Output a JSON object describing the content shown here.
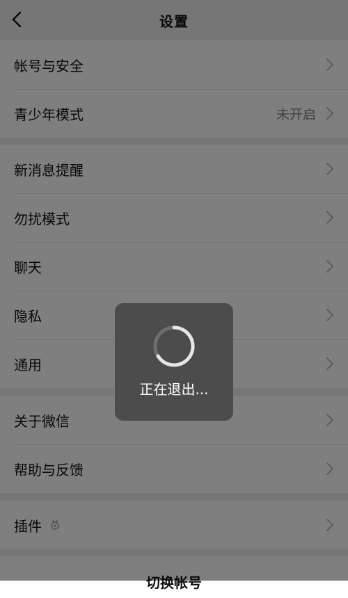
{
  "navbar": {
    "title": "设置",
    "back_icon": "chevron-left-icon"
  },
  "groups": [
    {
      "items": [
        {
          "label": "帐号与安全"
        },
        {
          "label": "青少年模式",
          "value": "未开启"
        }
      ]
    },
    {
      "items": [
        {
          "label": "新消息提醒"
        },
        {
          "label": "勿扰模式"
        },
        {
          "label": "聊天"
        },
        {
          "label": "隐私"
        },
        {
          "label": "通用"
        }
      ]
    },
    {
      "items": [
        {
          "label": "关于微信"
        },
        {
          "label": "帮助与反馈"
        }
      ]
    },
    {
      "items": [
        {
          "label": "插件",
          "icon": "plugin-icon"
        }
      ]
    }
  ],
  "bottom": {
    "switch_account": "切换帐号"
  },
  "toast": {
    "text": "正在退出...",
    "icon": "loading-spinner-icon"
  },
  "colors": {
    "background": "#ededed",
    "row_background": "#ffffff",
    "overlay": "rgba(0,0,0,0.5)",
    "toast_background": "#4c4c4c",
    "secondary_text": "#808080"
  }
}
